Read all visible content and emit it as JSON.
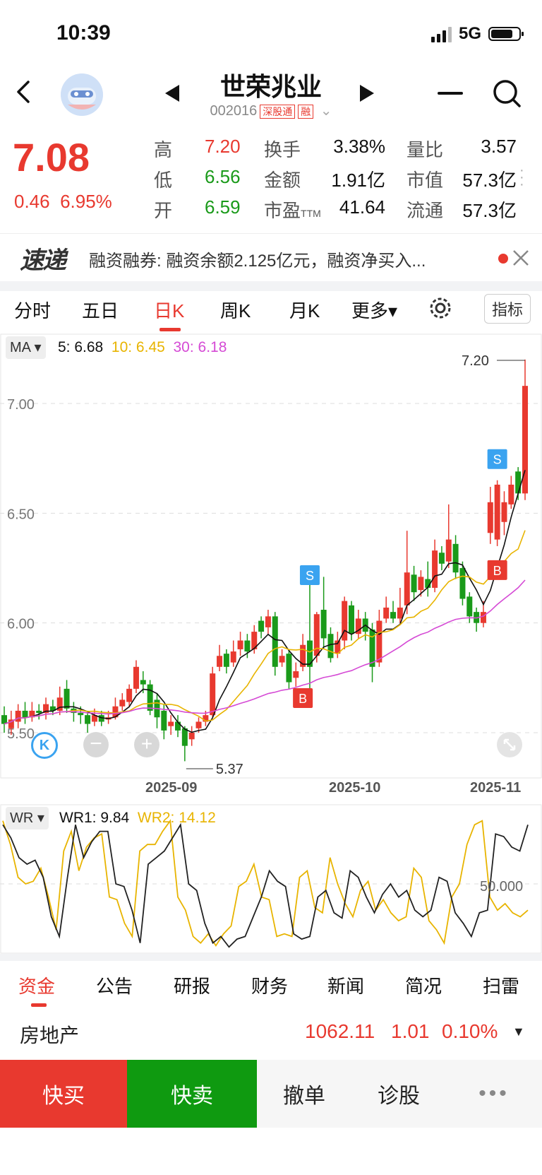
{
  "status": {
    "time": "10:39",
    "network": "5G"
  },
  "header": {
    "title": "世荣兆业",
    "code": "002016",
    "tags": [
      "深股通",
      "融"
    ]
  },
  "quote": {
    "price": "7.08",
    "change": "0.46",
    "change_pct": "6.95%",
    "high_label": "高",
    "high": "7.20",
    "low_label": "低",
    "low": "6.56",
    "open_label": "开",
    "open": "6.59",
    "turnover_label": "换手",
    "turnover": "3.38%",
    "amount_label": "金额",
    "amount": "1.91亿",
    "pe_label": "市盈",
    "pe_sub": "TTM",
    "pe": "41.64",
    "vol_ratio_label": "量比",
    "vol_ratio": "3.57",
    "mcap_label": "市值",
    "mcap": "57.3亿",
    "float_label": "流通",
    "float": "57.3亿"
  },
  "banner": {
    "logo": "速递",
    "text": "融资融券: 融资余额2.125亿元，融资净买入..."
  },
  "tabs": [
    "分时",
    "五日",
    "日K",
    "周K",
    "月K",
    "更多▾"
  ],
  "indicator_button": "指标",
  "ma_legend": {
    "selector": "MA",
    "ma5": "5: 6.68",
    "ma10": "10: 6.45",
    "ma30": "30: 6.18"
  },
  "wr_legend": {
    "selector": "WR",
    "wr1": "WR1: 9.84",
    "wr2": "WR2: 14.12",
    "level": "50.000"
  },
  "chart_data": {
    "type": "candlestick",
    "y_ticks": [
      "7.00",
      "6.50",
      "6.00",
      "5.50"
    ],
    "x_ticks": [
      "2025-09",
      "2025-10",
      "2025-11"
    ],
    "high_marker": "7.20",
    "low_marker": "5.37",
    "signals": [
      "S",
      "B",
      "S",
      "B"
    ]
  },
  "bottom_tabs": [
    "资金",
    "公告",
    "研报",
    "财务",
    "新闻",
    "简况",
    "扫雷"
  ],
  "sector": {
    "name": "房地产",
    "value": "1062.11",
    "change": "1.01",
    "pct": "0.10%"
  },
  "actions": {
    "buy": "快买",
    "sell": "快卖",
    "cancel": "撤单",
    "diagnose": "诊股",
    "more": "•••"
  },
  "colors": {
    "up": "#e8392f",
    "down": "#1a9a1a",
    "ma10": "#e8b400",
    "ma30": "#d54ad5"
  }
}
